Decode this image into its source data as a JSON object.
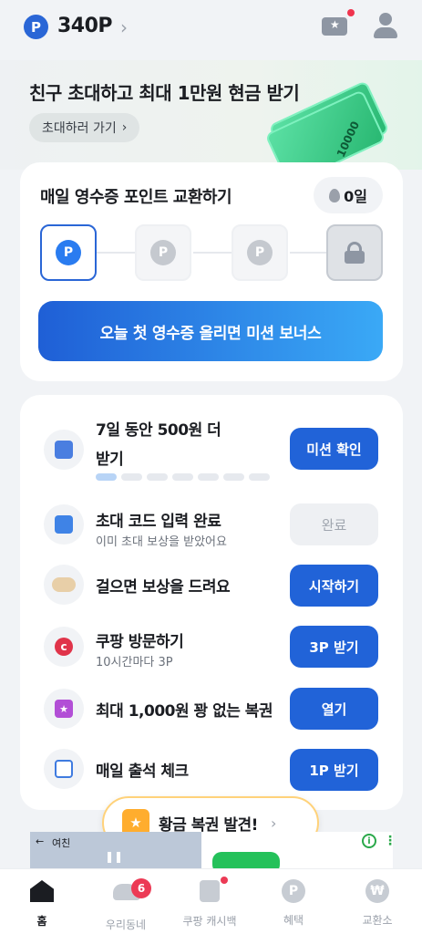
{
  "header": {
    "points_badge": "P",
    "points": "340P",
    "points_chevron": "›",
    "icons": [
      "ticket-icon",
      "user-icon"
    ]
  },
  "banner": {
    "title": "친구 초대하고 최대 1만원 현금 받기",
    "button": "초대하러 가기",
    "button_chevron": "›",
    "bill_value": "10000"
  },
  "receipt": {
    "title": "매일 영수증 포인트 교환하기",
    "streak": "0일",
    "step_badge": "P",
    "steps": [
      "active",
      "inactive",
      "inactive",
      "locked"
    ],
    "cta": "오늘 첫 영수증 올리면 미션 보너스"
  },
  "missions": [
    {
      "title_line1": "7일 동안 500원 더",
      "title_line2": "받기",
      "button": "미션 확인",
      "progress_done": 1,
      "progress_total": 7
    },
    {
      "title": "초대 코드 입력 완료",
      "subtitle": "이미 초대 보상을 받았어요",
      "button": "완료",
      "status": "done"
    },
    {
      "title": "걸으면 보상을 드려요",
      "button": "시작하기"
    },
    {
      "title": "쿠팡 방문하기",
      "subtitle": "10시간마다 3P",
      "button": "3P 받기",
      "icon_glyph": "c"
    },
    {
      "title": "최대 1,000원 꽝 없는 복권",
      "button": "열기",
      "icon_glyph": "★"
    },
    {
      "title": "매일 출석 체크",
      "button": "1P 받기"
    }
  ],
  "floating": {
    "label": "황금 복권 발견!",
    "icon_glyph": "★",
    "chevron": "›"
  },
  "ad": {
    "label": "여친",
    "back_arrow": "←",
    "pause": "❚❚",
    "info": "i",
    "more": "⋮"
  },
  "nav": {
    "items": [
      {
        "label": "홈",
        "active": true
      },
      {
        "label": "우리동네",
        "badge": "6"
      },
      {
        "label": "쿠팡 캐시백",
        "dot": true
      },
      {
        "label": "혜택",
        "icon_glyph": "P"
      },
      {
        "label": "교환소",
        "icon_glyph": "₩"
      }
    ]
  },
  "colors": {
    "primary": "#2163d8",
    "accent_red": "#ec3a55",
    "background": "#f1f3f6"
  }
}
